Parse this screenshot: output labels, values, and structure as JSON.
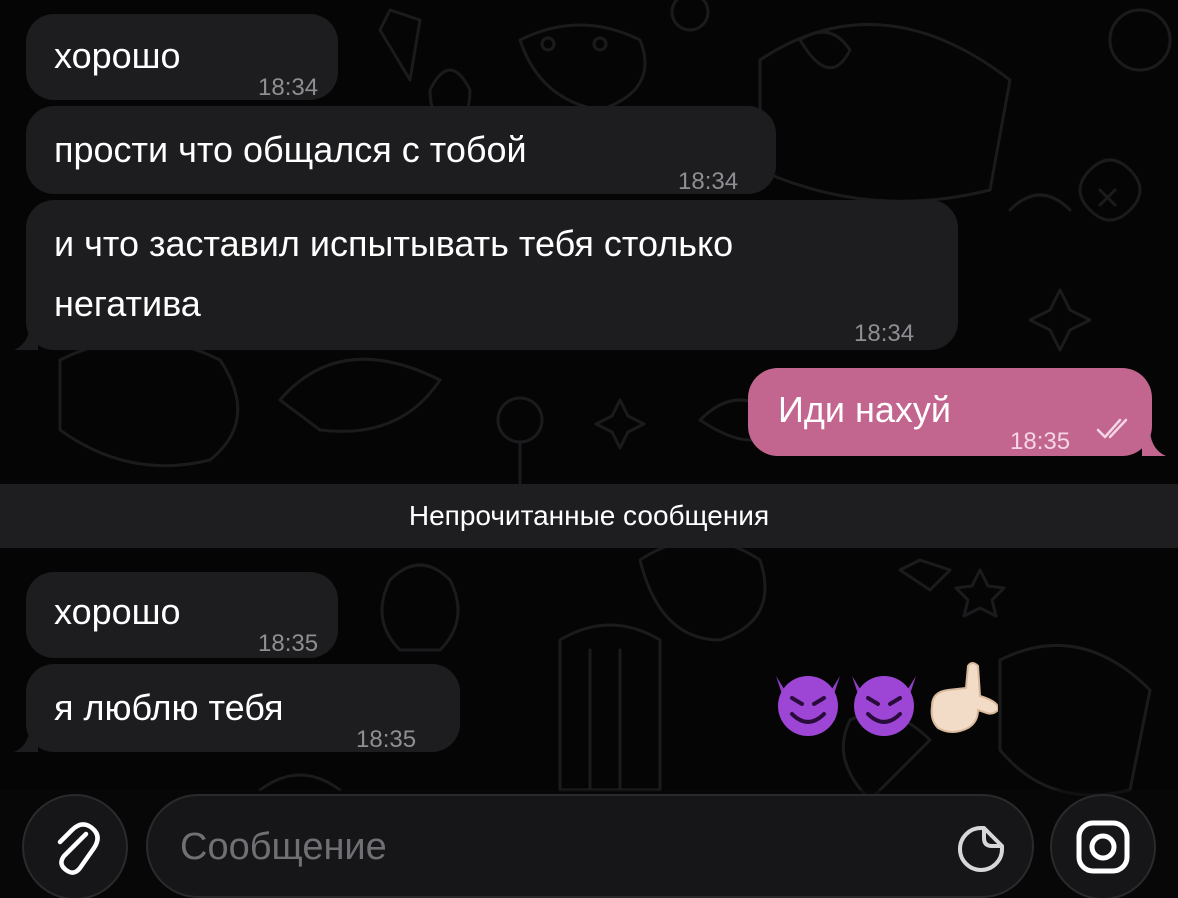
{
  "messages": [
    {
      "text": "хорошо",
      "time": "18:34"
    },
    {
      "text": "прости что общался с тобой",
      "time": "18:34"
    },
    {
      "line1": "и что заставил испытывать тебя столько",
      "line2": "негатива",
      "time": "18:34"
    },
    {
      "text": "Иди нахуй",
      "time": "18:35",
      "read_icon": "double-check-icon"
    },
    {
      "text": "хорошо",
      "time": "18:35"
    },
    {
      "text": "я люблю тебя",
      "time": "18:35"
    }
  ],
  "unread_label": "Непрочитанные сообщения",
  "reaction_emojis": [
    "smiling-devil-icon",
    "smiling-devil-icon",
    "call-me-hand-icon"
  ],
  "composer": {
    "placeholder": "Сообщение",
    "attach_icon": "paperclip-icon",
    "sticker_icon": "sticker-icon",
    "camera_icon": "camera-icon"
  },
  "colors": {
    "incoming_bubble": "#1d1c1f",
    "outgoing_bubble": "#c3668f",
    "background": "#050505"
  }
}
